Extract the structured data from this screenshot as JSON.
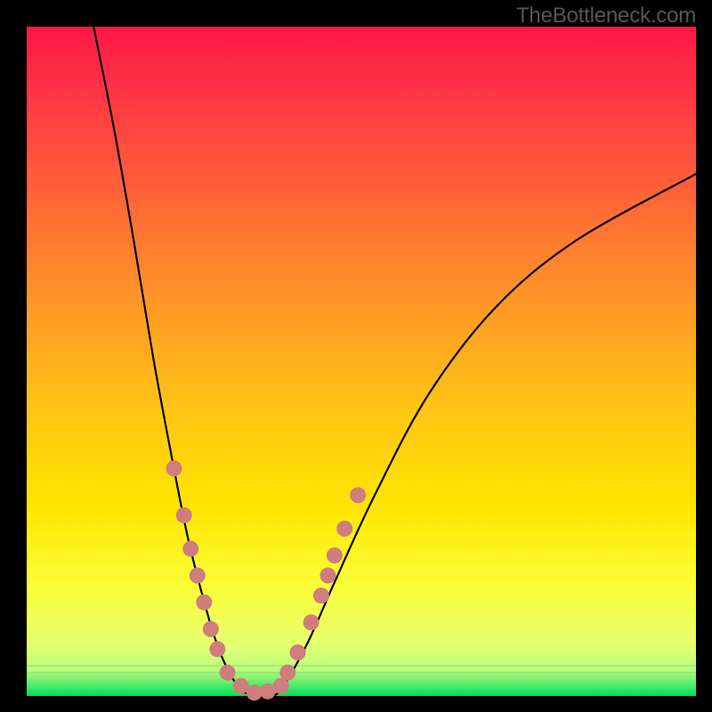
{
  "watermark": {
    "text": "TheBottleneck.com"
  },
  "chart_data": {
    "type": "line",
    "title": "",
    "xlabel": "",
    "ylabel": "",
    "xlim": [
      0,
      100
    ],
    "ylim": [
      0,
      100
    ],
    "curve": {
      "left": [
        {
          "x": 10,
          "y": 100
        },
        {
          "x": 13,
          "y": 85
        },
        {
          "x": 16,
          "y": 68
        },
        {
          "x": 19,
          "y": 50
        },
        {
          "x": 22,
          "y": 34
        },
        {
          "x": 24,
          "y": 24
        },
        {
          "x": 26,
          "y": 16
        },
        {
          "x": 28,
          "y": 9
        },
        {
          "x": 30,
          "y": 4
        },
        {
          "x": 32,
          "y": 1
        }
      ],
      "bottom": [
        {
          "x": 32,
          "y": 1
        },
        {
          "x": 34,
          "y": 0
        },
        {
          "x": 36,
          "y": 0
        },
        {
          "x": 38,
          "y": 1
        }
      ],
      "right": [
        {
          "x": 38,
          "y": 1
        },
        {
          "x": 42,
          "y": 8
        },
        {
          "x": 46,
          "y": 17
        },
        {
          "x": 52,
          "y": 30
        },
        {
          "x": 60,
          "y": 45
        },
        {
          "x": 70,
          "y": 58
        },
        {
          "x": 82,
          "y": 68
        },
        {
          "x": 100,
          "y": 78
        }
      ]
    },
    "markers": [
      {
        "x": 22.0,
        "y": 34
      },
      {
        "x": 23.5,
        "y": 27
      },
      {
        "x": 24.5,
        "y": 22
      },
      {
        "x": 25.5,
        "y": 18
      },
      {
        "x": 26.5,
        "y": 14
      },
      {
        "x": 27.5,
        "y": 10
      },
      {
        "x": 28.5,
        "y": 7
      },
      {
        "x": 30.0,
        "y": 3.5
      },
      {
        "x": 32.0,
        "y": 1.5
      },
      {
        "x": 34.0,
        "y": 0.5
      },
      {
        "x": 36.0,
        "y": 0.7
      },
      {
        "x": 38.0,
        "y": 1.5
      },
      {
        "x": 39.0,
        "y": 3.5
      },
      {
        "x": 40.5,
        "y": 6.5
      },
      {
        "x": 42.5,
        "y": 11
      },
      {
        "x": 44.0,
        "y": 15
      },
      {
        "x": 45.0,
        "y": 18
      },
      {
        "x": 46.0,
        "y": 21
      },
      {
        "x": 47.5,
        "y": 25
      },
      {
        "x": 49.5,
        "y": 30
      }
    ],
    "marker_radius": 9
  }
}
